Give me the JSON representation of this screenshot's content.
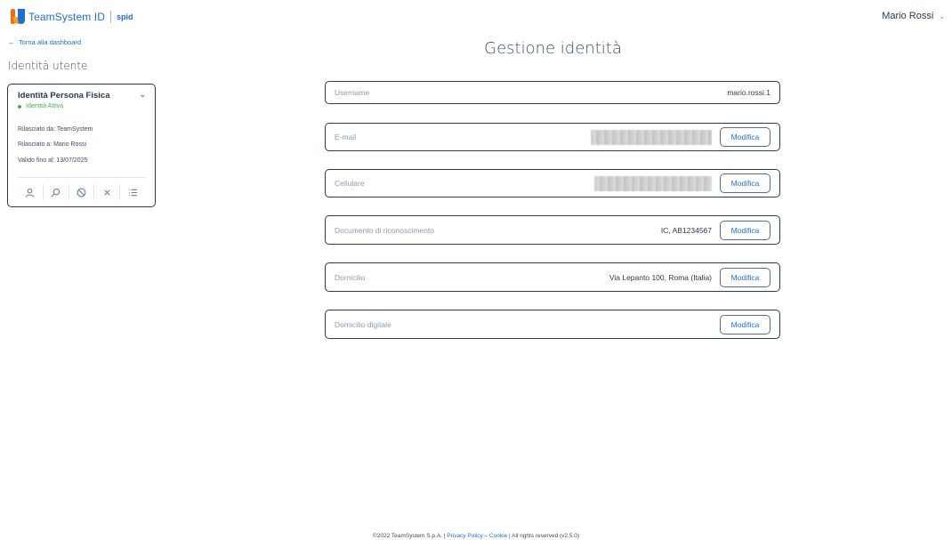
{
  "header": {
    "brand": "TeamSystem ID",
    "spid": "spid",
    "user_name": "Mario Rossi"
  },
  "sidebar": {
    "back_link": "Torna alla dashboard",
    "title": "Identità utente",
    "card": {
      "title": "Identità Persona Fisica",
      "status": "Identità Attiva",
      "issued_by": "Rilasciato da: TeamSystem",
      "issued_to": "Rilasciato a: Mario Rossi",
      "valid_until": "Valido fino al: 13/07/2025"
    }
  },
  "main": {
    "title": "Gestione identità",
    "button_label": "Modifica",
    "fields": [
      {
        "label": "Username",
        "value": "mario.rossi.1"
      },
      {
        "label": "E-mail",
        "value": ""
      },
      {
        "label": "Cellulare",
        "value": ""
      },
      {
        "label": "Documento di riconoscimento",
        "value": "IC, AB1234567"
      },
      {
        "label": "Domicilio",
        "value": "Via Lepanto 100, Roma (Italia)"
      },
      {
        "label": "Domicilio digitale",
        "value": ""
      }
    ]
  },
  "footer": {
    "copyright": "©2022 TeamSystem S.p.A. | ",
    "privacy": "Privacy Policy",
    "dash": " – ",
    "cookie": "Cookie",
    "rights": " | All rights reserved (v2.5.0)"
  },
  "colors": {
    "accent": "#1f6fd1",
    "status_active": "#4caf50",
    "border": "#2b3a4a"
  }
}
